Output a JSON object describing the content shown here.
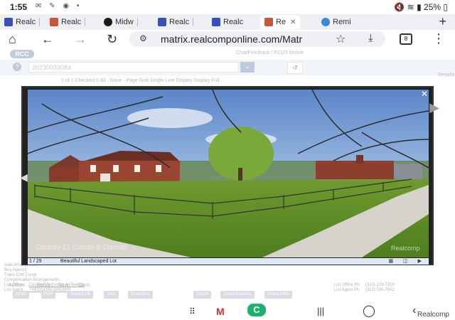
{
  "status": {
    "time": "1:55",
    "notif_icons": "✉ ✎ ◉ •",
    "battery": "25%"
  },
  "tabs": [
    {
      "label": "Realc",
      "icon": "site-square-icon"
    },
    {
      "label": "Realc",
      "icon": "house-icon"
    },
    {
      "label": "Midw",
      "icon": "globe-icon"
    },
    {
      "label": "Realc",
      "icon": "site-square-icon"
    },
    {
      "label": "Realc",
      "icon": "site-square-icon"
    },
    {
      "label": "Re",
      "icon": "house-icon",
      "active": true
    },
    {
      "label": "Remi",
      "icon": "remine-icon"
    }
  ],
  "browser": {
    "url": "matrix.realcomponline.com/Matr",
    "tab_count": "8"
  },
  "page": {
    "logo": "RCC",
    "top_links": "Chat/Feedback | RCO3 Mobile",
    "search_value": "20230033084",
    "results_link": "Results",
    "results_bar": "1 of 1   Checked 0   All · None · Page   Grid   Single Line Display   Display   Full"
  },
  "lightbox": {
    "counter": "1 / 29",
    "caption": "Beautiful Landscaped Lot",
    "watermark_left": "Century 21 Curran & Oberski",
    "watermark_right": "Realcomp"
  },
  "details": {
    "left": [
      "Sale Arrangement",
      "Buy Agency",
      "Trans Cmt Comp",
      "Compensation Arrangements",
      "List Office",
      "List Agent"
    ],
    "office_name": "Century 21 Curran & Oberski",
    "agent_name": "THEODORA BROWN",
    "right_labels": [
      "List Office Ph",
      "List Agent Ph"
    ],
    "office_phone": "(313) 278-7200",
    "agent_phone": "(313) 530-7641"
  },
  "actions": [
    "Actions",
    "Refine",
    "Save",
    "Carts"
  ],
  "action_buttons": [
    "Email",
    "Print",
    "Share Link",
    "CMA",
    "Directions",
    "Export",
    "Cloud Streams",
    "Cloud CMA"
  ],
  "nav": {
    "watermark": "Realcomp"
  }
}
